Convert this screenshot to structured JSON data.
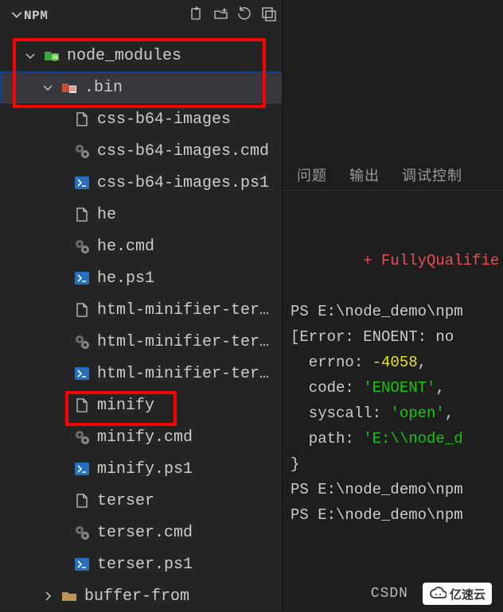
{
  "sidebar": {
    "section_title": "NPM",
    "tree": {
      "node_modules": {
        "label": "node_modules"
      },
      "bin": {
        "label": ".bin"
      },
      "files": [
        {
          "label": "css-b64-images",
          "type": "file"
        },
        {
          "label": "css-b64-images.cmd",
          "type": "gear"
        },
        {
          "label": "css-b64-images.ps1",
          "type": "ps1"
        },
        {
          "label": "he",
          "type": "file"
        },
        {
          "label": "he.cmd",
          "type": "gear"
        },
        {
          "label": "he.ps1",
          "type": "ps1"
        },
        {
          "label": "html-minifier-terser",
          "type": "file"
        },
        {
          "label": "html-minifier-terser...",
          "type": "gear"
        },
        {
          "label": "html-minifier-terser...",
          "type": "ps1"
        },
        {
          "label": "minify",
          "type": "file"
        },
        {
          "label": "minify.cmd",
          "type": "gear"
        },
        {
          "label": "minify.ps1",
          "type": "ps1"
        },
        {
          "label": "terser",
          "type": "file"
        },
        {
          "label": "terser.cmd",
          "type": "gear"
        },
        {
          "label": "terser.ps1",
          "type": "ps1"
        }
      ],
      "buffer_from": {
        "label": "buffer-from"
      }
    }
  },
  "terminal": {
    "tabs": {
      "problems": "问题",
      "output": "输出",
      "debug": "调试控制"
    },
    "lines": {
      "l0a": "+ FullyQualifie",
      "l1": "PS E:\\node_demo\\npm",
      "l2": "[Error: ENOENT: no ",
      "l3a": "  errno: ",
      "l3b": "-4058",
      "l3c": ",",
      "l4a": "  code: ",
      "l4b": "'ENOENT'",
      "l4c": ",",
      "l5a": "  syscall: ",
      "l5b": "'open'",
      "l5c": ",",
      "l6a": "  path: ",
      "l6b": "'E:\\\\node_d",
      "l7": "}",
      "l8": "PS E:\\node_demo\\npm",
      "l9": "PS E:\\node_demo\\npm"
    }
  },
  "footer": {
    "csdn": "CSDN",
    "cloud": "亿速云"
  }
}
